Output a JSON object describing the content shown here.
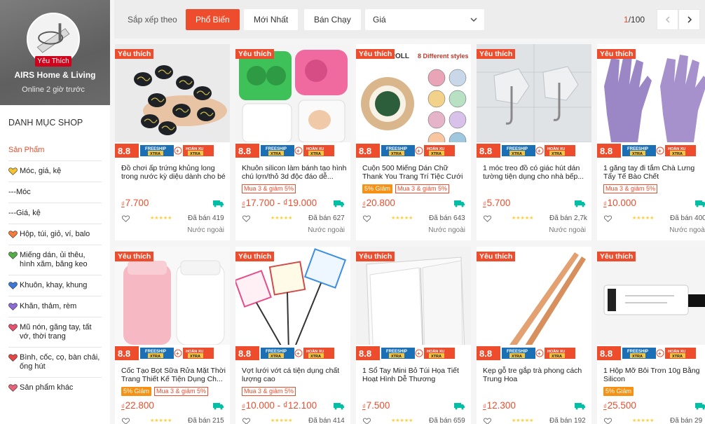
{
  "shop": {
    "name": "AIRS Home & Living",
    "badge": "Yêu Thích",
    "status": "Online 2 giờ trước"
  },
  "sidebar": {
    "title": "DANH MỤC SHOP",
    "items": [
      {
        "label": "Sản Phẩm",
        "active": true,
        "heart": ""
      },
      {
        "label": "Móc, giá, kệ",
        "heart": "#f4c430"
      },
      {
        "label": "---Móc",
        "heart": ""
      },
      {
        "label": "---Giá, kệ",
        "heart": ""
      },
      {
        "label": "Hộp, túi, giỏ, ví, balo",
        "heart": "#f57c3a"
      },
      {
        "label": "Miếng dán, ủi thêu, hình xăm, băng keo",
        "heart": "#52b043"
      },
      {
        "label": "Khuôn, khay, khung",
        "heart": "#3b78d8"
      },
      {
        "label": "Khăn, thảm, rèm",
        "heart": "#8e6ad8"
      },
      {
        "label": "Mũ nón, găng tay, tất vớ, thời trang",
        "heart": "#e8506f"
      },
      {
        "label": "Bình, cốc, cọ, bàn chải, ống hút",
        "heart": "#e84545"
      },
      {
        "label": "Sản phẩm khác",
        "heart": "#e8637a"
      }
    ]
  },
  "sortbar": {
    "label": "Sắp xếp theo",
    "options": [
      "Phổ Biến",
      "Mới Nhất",
      "Bán Chạy"
    ],
    "price_label": "Giá",
    "page_current": "1",
    "page_total": "/100"
  },
  "common": {
    "fav_tag": "Yêu thích",
    "currency": "₫",
    "origin": "Nước ngoài",
    "stars": "★★★★★"
  },
  "products": [
    {
      "title": "Đồ chơi ấp trứng khủng long trong nước kỳ diệu dành cho bé",
      "price": "7.700",
      "sold": "Đã bán 419",
      "origin": true,
      "tags": [],
      "art": "eggs"
    },
    {
      "title": "Khuôn silicon làm bánh tạo hình chú lợn/thỏ 3d độc đáo dễ...",
      "price": "17.700 - ₫19.000",
      "sold": "Đã bán 627",
      "origin": true,
      "tags": [
        {
          "t": "deal",
          "text": "Mua 3 & giảm 5%"
        }
      ],
      "art": "molds"
    },
    {
      "title": "Cuộn 500 Miếng Dán Chữ Thank You Trang Trí Tiệc Cưới",
      "price": "20.800",
      "sold": "Đã bán 643",
      "origin": true,
      "tags": [
        {
          "t": "discount",
          "text": "5% Giảm"
        },
        {
          "t": "deal",
          "text": "Mua 3 & giảm 5%"
        }
      ],
      "art": "stickers",
      "art_text": "500 PCS/ROLL",
      "art_text2": "8 Different styles"
    },
    {
      "title": "1 móc treo đồ có giác hút dán tường tiện dụng cho nhà bếp...",
      "price": "5.700",
      "sold": "Đã bán 2,7k",
      "origin": true,
      "tags": [],
      "art": "hooks"
    },
    {
      "title": "1 găng tay đi tắm Chà Lưng Tẩy Tế Bào Chết",
      "price": "10.000",
      "sold": "Đã bán 400",
      "origin": true,
      "tags": [
        {
          "t": "deal",
          "text": "Mua 3 & giảm 5%"
        }
      ],
      "art": "gloves"
    },
    {
      "title": "Cốc Tạo Bọt Sữa Rửa Mặt Thời Trang Thiết Kế Tiện Dụng Ch...",
      "price": "22.800",
      "sold": "Đã bán 215",
      "origin": false,
      "tags": [
        {
          "t": "discount",
          "text": "5% Giảm"
        },
        {
          "t": "deal",
          "text": "Mua 3 & giảm 5%"
        }
      ],
      "art": "cups"
    },
    {
      "title": "Vợt lưới vớt cá tiện dụng chất lượng cao",
      "price": "10.000 - ₫12.100",
      "sold": "Đã bán 414",
      "origin": false,
      "tags": [
        {
          "t": "deal",
          "text": "Mua 3 & giảm 5%"
        }
      ],
      "art": "nets"
    },
    {
      "title": "1 Sổ Tay Mini Bỏ Túi Họa Tiết Hoạt Hình Dễ Thương",
      "price": "7.500",
      "sold": "Đã bán 659",
      "origin": false,
      "tags": [],
      "art": "notebook"
    },
    {
      "title": "Kẹp gỗ tre gắp trà phong cách Trung Hoa",
      "price": "12.300",
      "sold": "Đã bán 192",
      "origin": false,
      "tags": [],
      "art": "tongs"
    },
    {
      "title": "1 Hộp Mỡ Bôi Trơn 10g Bằng Silicon",
      "price": "25.500",
      "sold": "Đã bán 29",
      "origin": false,
      "tags": [
        {
          "t": "discount",
          "text": "5% Giảm"
        }
      ],
      "art": "tube"
    }
  ],
  "promo": {
    "big": "8.8",
    "freeship": "FREESHIP",
    "xtra": "XTRA",
    "hoanxu": "HOÀN XU"
  },
  "colors": {
    "accent": "#ee4d2d",
    "discount": "#f69113",
    "star": "#ffce3d"
  }
}
